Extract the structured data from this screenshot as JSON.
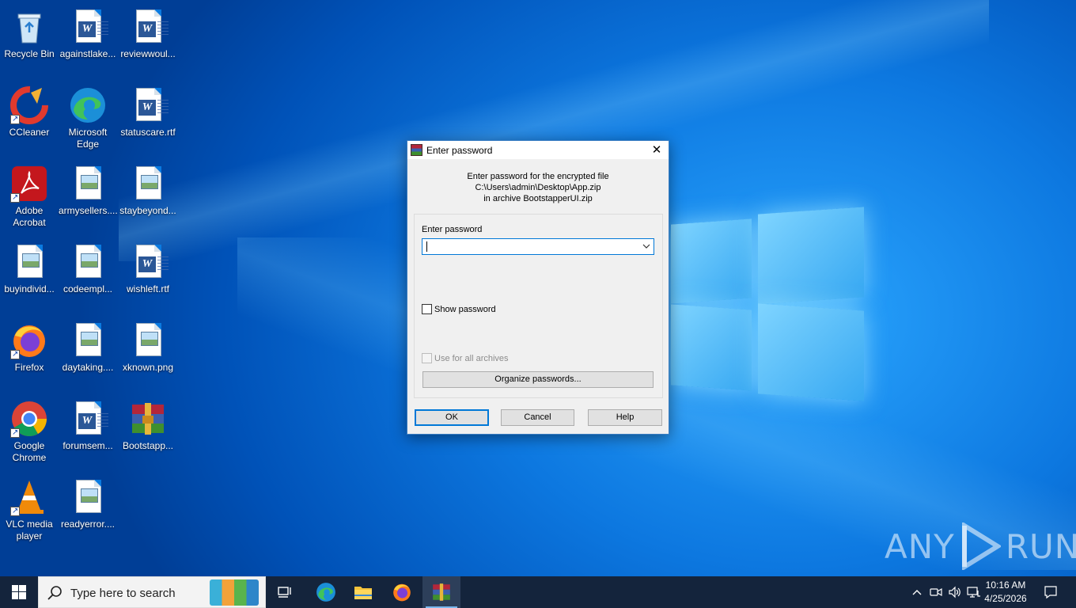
{
  "desktop": {
    "icons": [
      {
        "label": "Recycle Bin",
        "icon": "recycle-bin-icon"
      },
      {
        "label": "againstlake...",
        "icon": "word-doc-icon"
      },
      {
        "label": "reviewwoul...",
        "icon": "word-doc-icon"
      },
      {
        "label": "CCleaner",
        "icon": "ccleaner-icon"
      },
      {
        "label": "Microsoft Edge",
        "icon": "edge-icon"
      },
      {
        "label": "statuscare.rtf",
        "icon": "word-doc-icon"
      },
      {
        "label": "Adobe Acrobat",
        "icon": "acrobat-icon"
      },
      {
        "label": "armysellers....",
        "icon": "image-file-icon"
      },
      {
        "label": "staybeyond...",
        "icon": "image-file-icon"
      },
      {
        "label": "buyindivid...",
        "icon": "image-file-icon"
      },
      {
        "label": "codeempl...",
        "icon": "image-file-icon"
      },
      {
        "label": "wishleft.rtf",
        "icon": "word-doc-icon"
      },
      {
        "label": "Firefox",
        "icon": "firefox-icon"
      },
      {
        "label": "daytaking....",
        "icon": "image-file-icon"
      },
      {
        "label": "xknown.png",
        "icon": "image-file-icon"
      },
      {
        "label": "Google Chrome",
        "icon": "chrome-icon"
      },
      {
        "label": "forumsem...",
        "icon": "word-doc-icon"
      },
      {
        "label": "Bootstapp...",
        "icon": "winrar-archive-icon"
      },
      {
        "label": "VLC media player",
        "icon": "vlc-icon"
      },
      {
        "label": "readyerror....",
        "icon": "image-file-icon"
      }
    ]
  },
  "dialog": {
    "title": "Enter password",
    "info_line1": "Enter password for the encrypted file",
    "info_line2": "C:\\Users\\admin\\Desktop\\App.zip",
    "info_line3": "in archive BootstapperUI.zip",
    "password_label": "Enter password",
    "password_value": "",
    "show_password_label": "Show password",
    "use_all_label": "Use for all archives",
    "organize_label": "Organize passwords...",
    "ok_label": "OK",
    "cancel_label": "Cancel",
    "help_label": "Help"
  },
  "taskbar": {
    "search_placeholder": "Type here to search",
    "pinned": [
      "task-view-icon",
      "edge-icon",
      "file-explorer-icon",
      "firefox-icon",
      "winrar-icon"
    ],
    "active_app": "winrar-icon"
  },
  "tray": {
    "time": "10:16 AM",
    "date": "4/25/2026"
  },
  "watermark": {
    "left": "ANY",
    "right": "RUN"
  },
  "colors": {
    "accent": "#0078d7",
    "taskbar": "#14243c"
  }
}
